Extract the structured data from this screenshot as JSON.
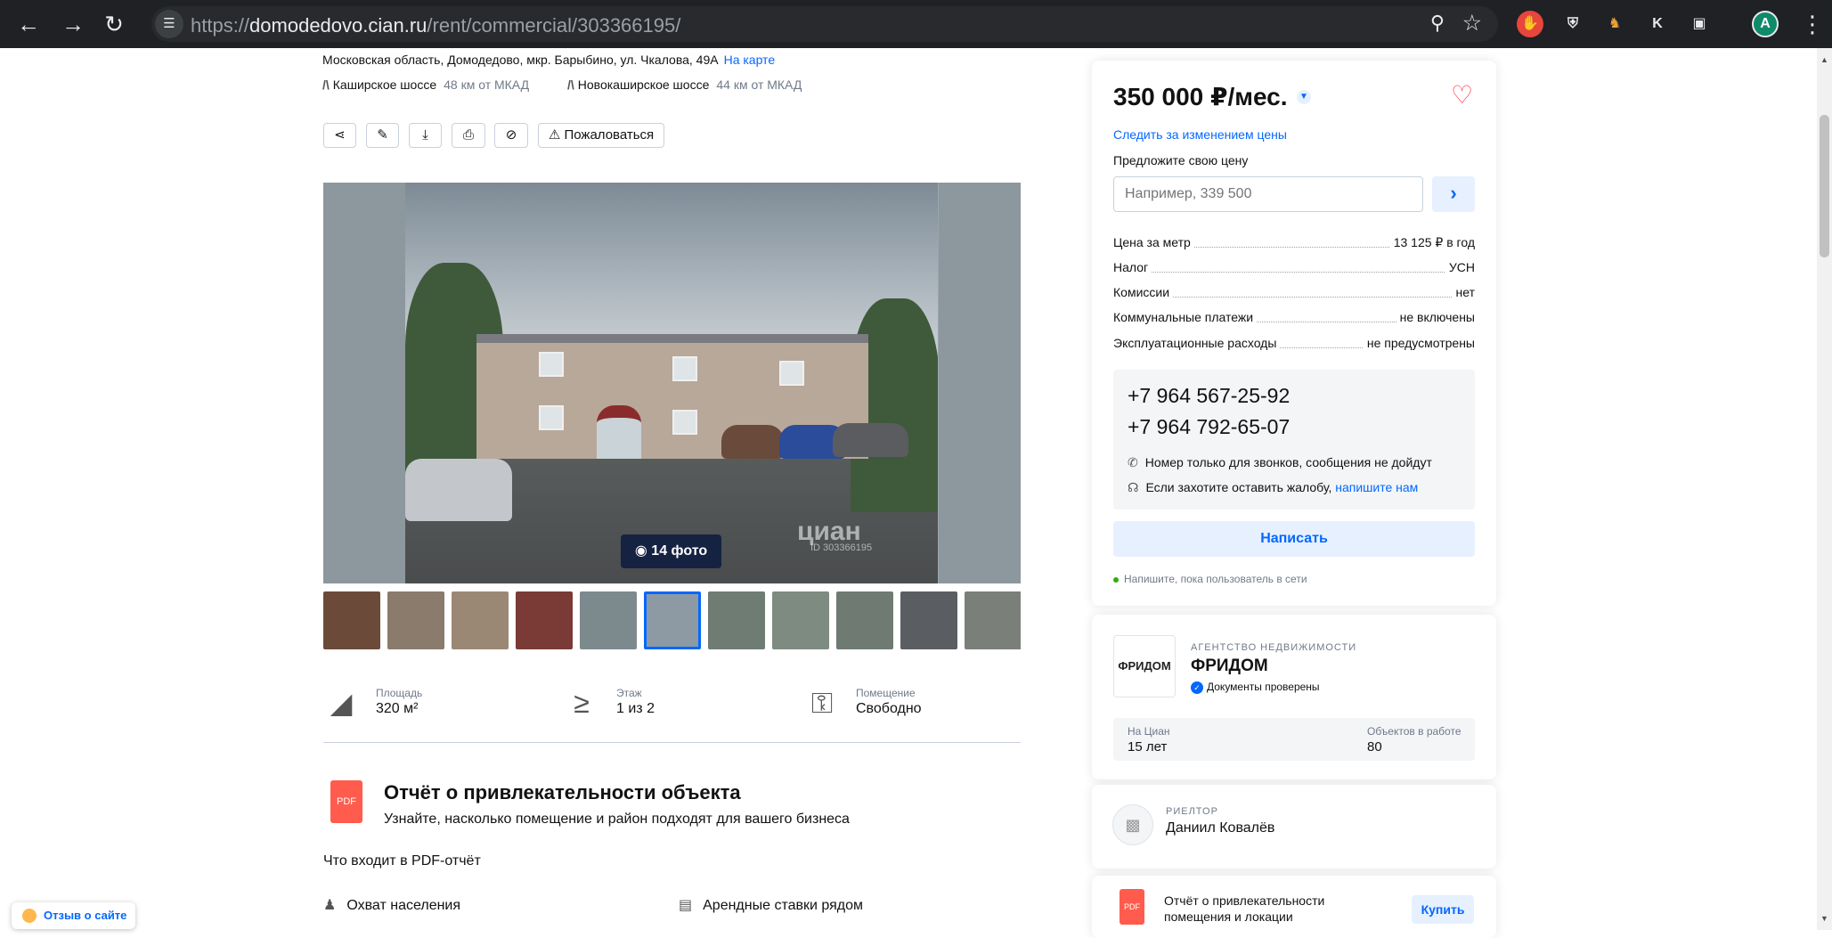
{
  "browser": {
    "url_prefix": "https://",
    "url_domain": "domodedovo.cian.ru",
    "url_path": "/rent/commercial/303366195/",
    "profile_initial": "A",
    "ext_k": "K"
  },
  "listing": {
    "address": "Московская область, Домодедово, мкр. Барыбино, ул. Чкалова, 49А",
    "map_link": "На карте",
    "highways": [
      {
        "name": "Каширское шоссе",
        "distance": "48 км от МКАД"
      },
      {
        "name": "Новокаширское шоссе",
        "distance": "44 км от МКАД"
      }
    ],
    "complain_label": "Пожаловаться",
    "photo_count": "14 фото",
    "watermark": "циан",
    "watermark_id": "ID 303366195",
    "features": [
      {
        "label": "Площадь",
        "value": "320 м²",
        "icon": "area-icon"
      },
      {
        "label": "Этаж",
        "value": "1 из 2",
        "icon": "stairs-icon"
      },
      {
        "label": "Помещение",
        "value": "Свободно",
        "icon": "key-icon"
      }
    ]
  },
  "report": {
    "pdf_label": "PDF",
    "title": "Отчёт о привлекательности объекта",
    "subtitle": "Узнайте, насколько помещение и район подходят для вашего бизнеса",
    "includes_label": "Что входит в PDF-отчёт",
    "items": [
      "Охват населения",
      "Арендные ставки рядом"
    ]
  },
  "feedback": "Отзыв о сайте",
  "price": {
    "amount": "350 000 ₽/мес.",
    "track": "Следить за изменением цены",
    "offer_label": "Предложите свою цену",
    "offer_placeholder": "Например, 339 500",
    "details": [
      {
        "k": "Цена за метр",
        "v": "13 125 ₽ в год"
      },
      {
        "k": "Налог",
        "v": "УСН"
      },
      {
        "k": "Комиссии",
        "v": "нет"
      },
      {
        "k": "Коммунальные платежи",
        "v": "не включены"
      },
      {
        "k": "Эксплуатационные расходы",
        "v": "не предусмотрены"
      }
    ]
  },
  "contacts": {
    "phones": [
      "+7 964 567-25-92",
      "+7 964 792-65-07"
    ],
    "note_calls": "Номер только для звонков, сообщения не дойдут",
    "note_complaint": "Если захотите оставить жалобу,",
    "note_complaint_link": "напишите нам",
    "write_label": "Написать",
    "online_note": "Напишите, пока пользователь в сети"
  },
  "agency": {
    "logo_text": "ФРИДОМ",
    "type": "АГЕНТСТВО НЕДВИЖИМОСТИ",
    "name": "ФРИДОМ",
    "verified": "Документы проверены",
    "stats": [
      {
        "label": "На Циан",
        "value": "15 лет"
      },
      {
        "label": "Объектов в работе",
        "value": "80"
      }
    ]
  },
  "realtor": {
    "type": "РИЕЛТОР",
    "name": "Даниил Ковалёв"
  },
  "buy_report": {
    "pdf_label": "PDF",
    "text": "Отчёт о привлекательности помещения и локации",
    "button": "Купить"
  },
  "colors": {
    "accent": "#0468ff",
    "heart": "#ff3b4a",
    "photo_count_bg": "#152242",
    "pdf": "#ff5c4d",
    "online": "#34ac0a"
  }
}
